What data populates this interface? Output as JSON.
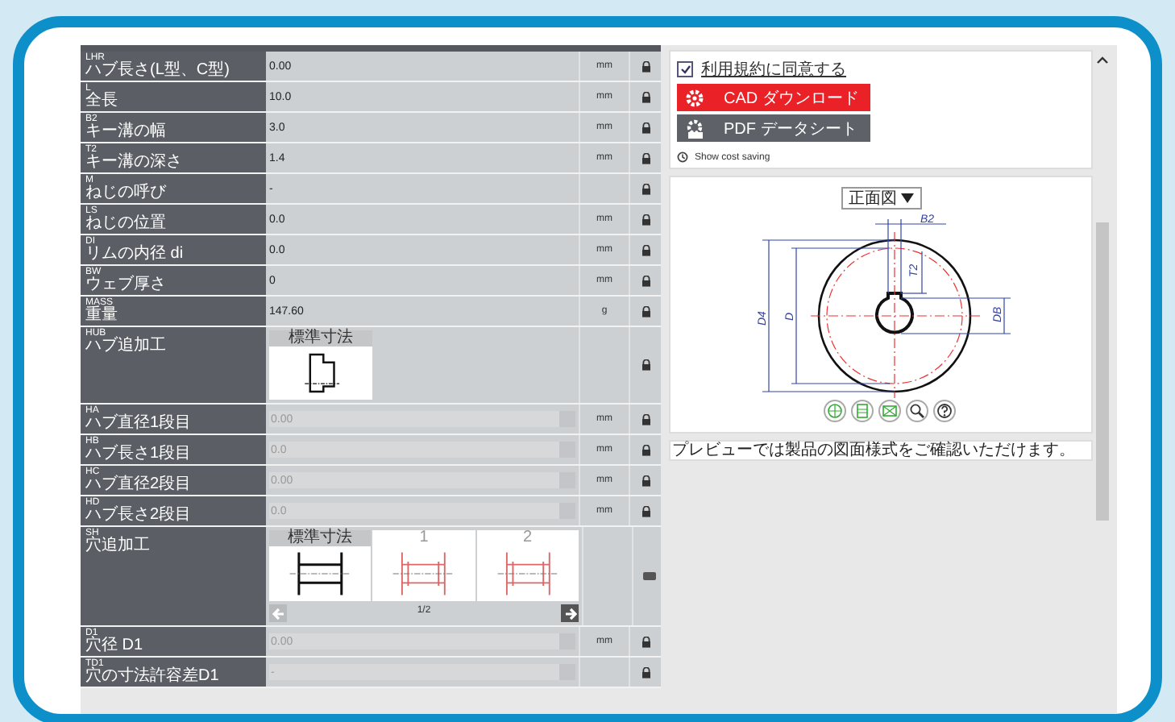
{
  "rows": [
    {
      "code": "LHR",
      "name": "ハブ長さ(L型、C型)",
      "kind": "text",
      "value": "0.00",
      "unit": "mm",
      "locked": true
    },
    {
      "code": "L",
      "name": "全長",
      "kind": "text",
      "value": "10.0",
      "unit": "mm",
      "locked": true
    },
    {
      "code": "B2",
      "name": "キー溝の幅",
      "kind": "text",
      "value": "3.0",
      "unit": "mm",
      "locked": true
    },
    {
      "code": "T2",
      "name": "キー溝の深さ",
      "kind": "text",
      "value": "1.4",
      "unit": "mm",
      "locked": true
    },
    {
      "code": "M",
      "name": "ねじの呼び",
      "kind": "text",
      "value": "-",
      "locked": true
    },
    {
      "code": "LS",
      "name": "ねじの位置",
      "kind": "text",
      "value": "0.0",
      "unit": "mm",
      "locked": true
    },
    {
      "code": "DI",
      "name": "リムの内径 di",
      "kind": "text",
      "value": "0.0",
      "unit": "mm",
      "locked": true
    },
    {
      "code": "BW",
      "name": "ウェブ厚さ",
      "kind": "text",
      "value": "0",
      "unit": "mm",
      "locked": true
    },
    {
      "code": "MASS",
      "name": "重量",
      "kind": "text",
      "value": "147.60",
      "unit": "g",
      "locked": true
    },
    {
      "code": "HUB",
      "name": "ハブ追加工",
      "kind": "image",
      "header": "標準寸法",
      "locked": true
    },
    {
      "code": "HA",
      "name": "ハブ直径1段目",
      "kind": "select",
      "value": "0.00",
      "unit": "mm",
      "locked": true
    },
    {
      "code": "HB",
      "name": "ハブ長さ1段目",
      "kind": "select",
      "value": "0.0",
      "unit": "mm",
      "locked": true
    },
    {
      "code": "HC",
      "name": "ハブ直径2段目",
      "kind": "select",
      "value": "0.00",
      "unit": "mm",
      "locked": true
    },
    {
      "code": "HD",
      "name": "ハブ長さ2段目",
      "kind": "select",
      "value": "0.0",
      "unit": "mm",
      "locked": true
    },
    {
      "code": "SH",
      "name": "穴追加工",
      "kind": "gallery",
      "options": [
        {
          "label": "標準寸法",
          "selected": true
        },
        {
          "label": "1",
          "selected": false
        },
        {
          "label": "2",
          "selected": false
        }
      ],
      "page": "1/2",
      "locked": false
    },
    {
      "code": "D1",
      "name": "穴径 D1",
      "kind": "select",
      "value": "0.00",
      "unit": "mm",
      "locked": true
    },
    {
      "code": "TD1",
      "name": "穴の寸法許容差D1",
      "kind": "select",
      "value": "-",
      "locked": true
    }
  ],
  "side": {
    "agree": {
      "label": "利用規約に同意する",
      "checked": true
    },
    "cad_button": "CAD ダウンロード",
    "pdf_button": "PDF データシート",
    "cost_saving": "Show cost saving",
    "view_select": "正面図",
    "dimension_labels": [
      "B2",
      "T2",
      "D4",
      "D",
      "DB"
    ],
    "note": "プレビューでは製品の図面様式をご確認いただけます。"
  }
}
